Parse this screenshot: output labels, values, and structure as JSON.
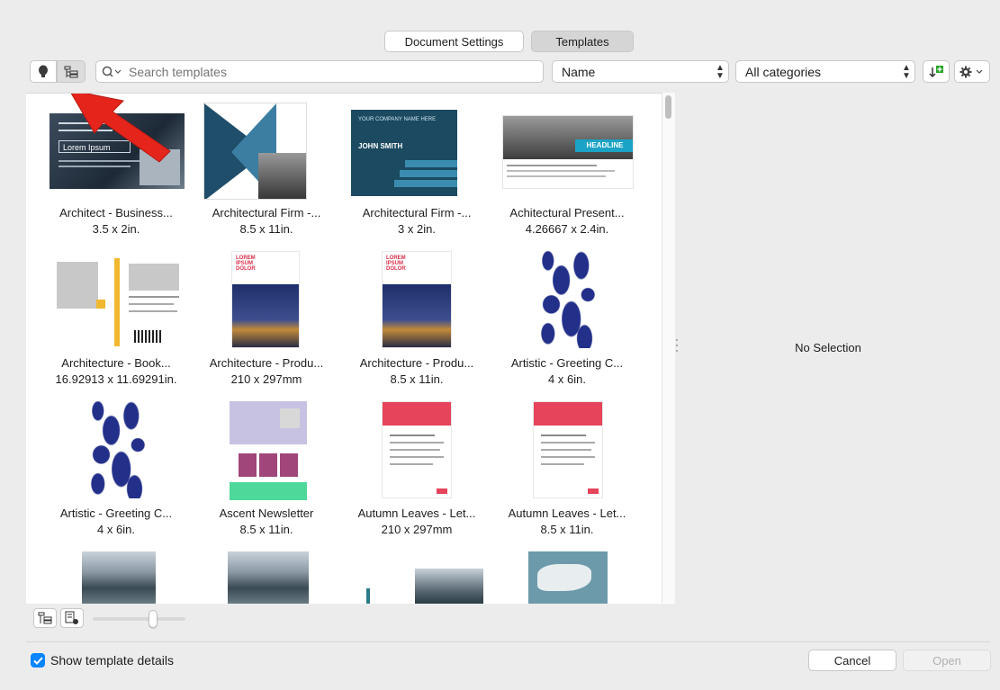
{
  "tabs": {
    "document_settings": "Document Settings",
    "templates": "Templates"
  },
  "toolbar": {
    "search_placeholder": "Search templates",
    "sort_value": "Name",
    "category_value": "All categories"
  },
  "templates": [
    {
      "name": "Architect - Business...",
      "size": "3.5 x 2in."
    },
    {
      "name": "Architectural Firm -...",
      "size": "8.5 x 11in."
    },
    {
      "name": "Architectural Firm -...",
      "size": "3 x 2in."
    },
    {
      "name": "Achitectural Present...",
      "size": "4.26667 x 2.4in."
    },
    {
      "name": "Architecture - Book...",
      "size": "16.92913 x 11.69291in."
    },
    {
      "name": "Architecture - Produ...",
      "size": "210 x 297mm"
    },
    {
      "name": "Architecture - Produ...",
      "size": "8.5 x 11in."
    },
    {
      "name": "Artistic - Greeting C...",
      "size": "4 x 6in."
    },
    {
      "name": "Artistic - Greeting C...",
      "size": "4 x 6in."
    },
    {
      "name": "Ascent Newsletter",
      "size": "8.5 x 11in."
    },
    {
      "name": "Autumn Leaves - Let...",
      "size": "210 x 297mm"
    },
    {
      "name": "Autumn Leaves - Let...",
      "size": "8.5 x 11in."
    }
  ],
  "thumb_text": {
    "t3_name": "JOHN SMITH",
    "t3_header": "YOUR COMPANY NAME HERE",
    "t4_headline": "HEADLINE",
    "t6_title": "LOREM IPSUM DOLOR",
    "t7_title": "LOREM IPSUM DOLOR",
    "t1_name": "Lorem Ipsum"
  },
  "detail": {
    "no_selection": "No Selection"
  },
  "footer": {
    "show_details_label": "Show template details",
    "show_details_checked": true,
    "cancel_label": "Cancel",
    "open_label": "Open"
  },
  "colors": {
    "accent": "#0a84ff",
    "annotation_arrow": "#e5251b"
  },
  "zoom_slider_fraction": 0.65
}
